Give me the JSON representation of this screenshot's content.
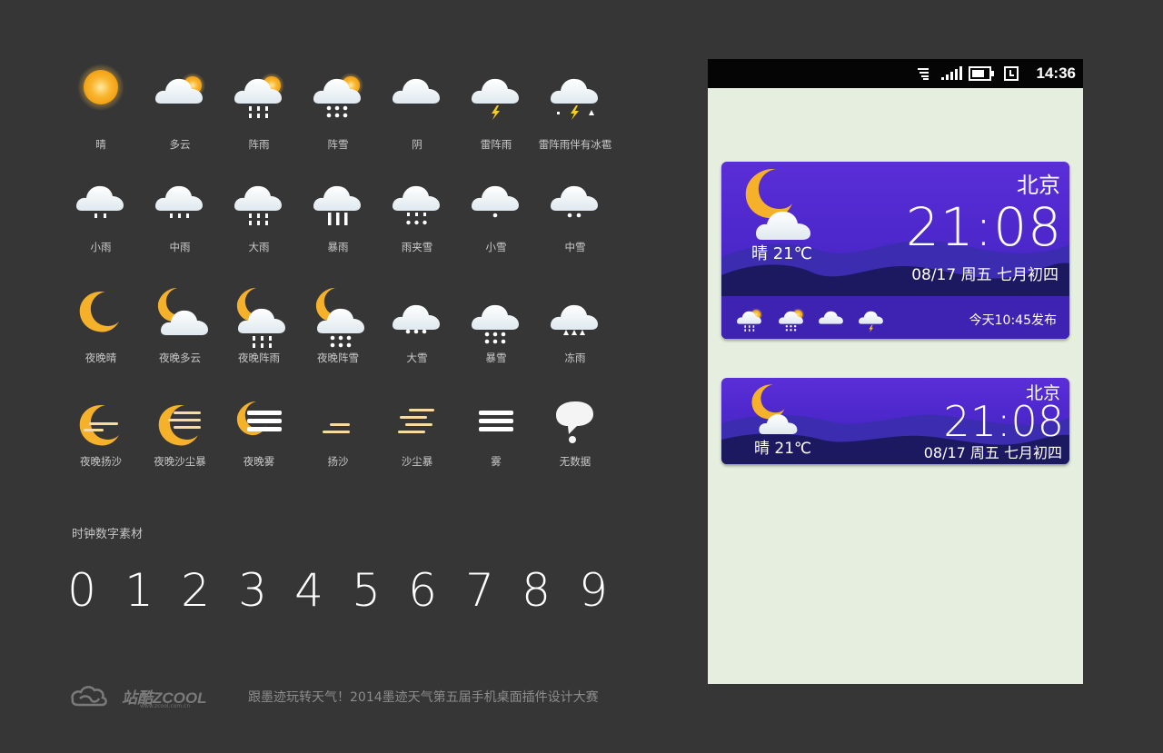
{
  "icons": {
    "rows": [
      [
        {
          "icon": "sun-icon",
          "label": "晴"
        },
        {
          "icon": "cloudy-icon",
          "label": "多云"
        },
        {
          "icon": "shower-rain-icon",
          "label": "阵雨"
        },
        {
          "icon": "shower-snow-icon",
          "label": "阵雪"
        },
        {
          "icon": "overcast-icon",
          "label": "阴"
        },
        {
          "icon": "thunder-shower-icon",
          "label": "雷阵雨"
        },
        {
          "icon": "thunder-hail-icon",
          "label": "雷阵雨伴有冰雹"
        }
      ],
      [
        {
          "icon": "light-rain-icon",
          "label": "小雨"
        },
        {
          "icon": "moderate-rain-icon",
          "label": "中雨"
        },
        {
          "icon": "heavy-rain-icon",
          "label": "大雨"
        },
        {
          "icon": "rainstorm-icon",
          "label": "暴雨"
        },
        {
          "icon": "sleet-icon",
          "label": "雨夹雪"
        },
        {
          "icon": "light-snow-icon",
          "label": "小雪"
        },
        {
          "icon": "moderate-snow-icon",
          "label": "中雪"
        }
      ],
      [
        {
          "icon": "night-clear-icon",
          "label": "夜晚晴"
        },
        {
          "icon": "night-cloudy-icon",
          "label": "夜晚多云"
        },
        {
          "icon": "night-shower-rain-icon",
          "label": "夜晚阵雨"
        },
        {
          "icon": "night-shower-snow-icon",
          "label": "夜晚阵雪"
        },
        {
          "icon": "heavy-snow-icon",
          "label": "大雪"
        },
        {
          "icon": "snowstorm-icon",
          "label": "暴雪"
        },
        {
          "icon": "freezing-rain-icon",
          "label": "冻雨"
        }
      ],
      [
        {
          "icon": "night-blowing-sand-icon",
          "label": "夜晚扬沙"
        },
        {
          "icon": "night-sandstorm-icon",
          "label": "夜晚沙尘暴"
        },
        {
          "icon": "night-fog-icon",
          "label": "夜晚雾"
        },
        {
          "icon": "blowing-sand-icon",
          "label": "扬沙"
        },
        {
          "icon": "sandstorm-icon",
          "label": "沙尘暴"
        },
        {
          "icon": "fog-icon",
          "label": "雾"
        },
        {
          "icon": "no-data-icon",
          "label": "无数据"
        }
      ]
    ]
  },
  "digits_section": {
    "title": "时钟数字素材",
    "digits": [
      "0",
      "1",
      "2",
      "3",
      "4",
      "5",
      "6",
      "7",
      "8",
      "9"
    ]
  },
  "footer": {
    "logo_text": "站酷ZCOOL",
    "logo_url_text": "www.zcool.com.cn",
    "caption": "跟墨迹玩转天气！2014墨迹天气第五届手机桌面插件设计大赛"
  },
  "phone": {
    "status_time": "14:36",
    "status_icons": [
      "notification-icon",
      "signal-icon",
      "battery-icon",
      "clock-icon"
    ]
  },
  "widget_large": {
    "city": "北京",
    "time": "21:08",
    "date": "08/17 周五 七月初四",
    "condition": "晴 21℃",
    "publish": "今天10:45发布",
    "forecast_icons": [
      "shower-rain-icon",
      "shower-snow-icon",
      "overcast-icon",
      "thunder-shower-icon"
    ]
  },
  "widget_small": {
    "city": "北京",
    "time": "21:08",
    "date": "08/17 周五 七月初四",
    "condition": "晴 21℃"
  },
  "colors": {
    "background": "#363636",
    "phone_screen": "#e6efdf",
    "widget_purple": "#4f2ad0",
    "widget_hills": "#1e1a5e",
    "sun_yellow": "#f7b52c",
    "moon_yellow": "#f5b12a",
    "label_gray": "#c9c9c9"
  }
}
